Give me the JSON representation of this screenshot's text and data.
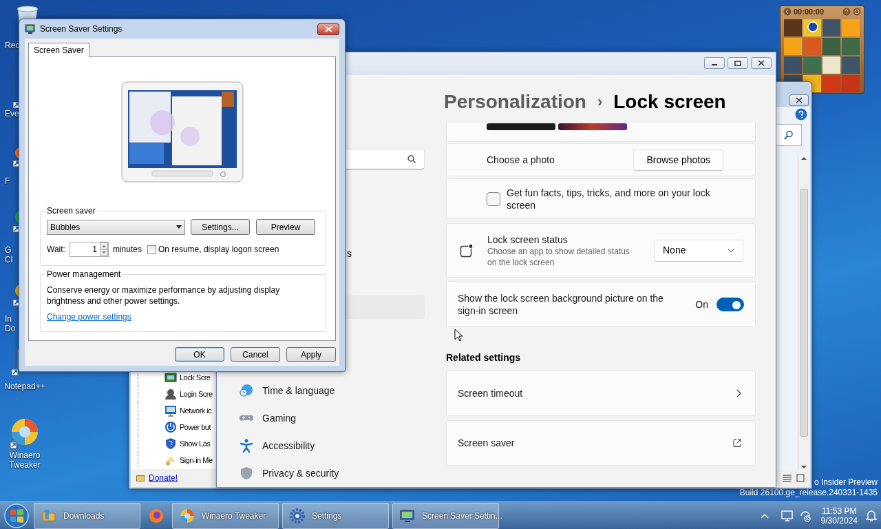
{
  "desktop_icons": [
    {
      "label": "Rec"
    },
    {
      "label": "Eve"
    },
    {
      "label": "F"
    },
    {
      "label": "G Cl"
    },
    {
      "label": "In Do"
    },
    {
      "label": "Notepad++"
    },
    {
      "label": "Winaero Tweaker"
    }
  ],
  "desktop_watermark": [
    "o Insider Preview",
    "Build 26100.ge_release.240331-1435"
  ],
  "puzzle_gadget": {
    "timer": "00:00:00"
  },
  "winaero_window": {
    "tree_items": [
      {
        "label": "Lock Scre"
      },
      {
        "label": "Login Scre"
      },
      {
        "label": "Network ic"
      },
      {
        "label": "Power but"
      },
      {
        "label": "Show Las"
      },
      {
        "label": "Sign-in Me"
      }
    ],
    "donate_link": "Donate!"
  },
  "settings_window": {
    "nav_partial_text": "s",
    "nav_items": [
      {
        "label": "Time & language"
      },
      {
        "label": "Gaming"
      },
      {
        "label": "Accessibility"
      },
      {
        "label": "Privacy & security"
      }
    ],
    "breadcrumb": {
      "parent": "Personalization",
      "separator": "›",
      "current": "Lock screen"
    },
    "choose_photo": {
      "label": "Choose a photo",
      "button": "Browse photos"
    },
    "fun_facts": {
      "label": "Get fun facts, tips, tricks, and more on your lock screen",
      "checked": false
    },
    "status": {
      "title": "Lock screen status",
      "description": "Choose an app to show detailed status on the lock screen",
      "value": "None"
    },
    "signin_background": {
      "label": "Show the lock screen background picture on the sign-in screen",
      "state_label": "On",
      "on": true
    },
    "related_title": "Related settings",
    "related": [
      {
        "label": "Screen timeout",
        "kind": "chevron"
      },
      {
        "label": "Screen saver",
        "kind": "external"
      }
    ]
  },
  "screen_saver_dialog": {
    "title": "Screen Saver Settings",
    "tabs": [
      {
        "label": "Screen Saver",
        "selected": true
      }
    ],
    "screen_saver_group": {
      "title": "Screen saver",
      "selected_saver": "Bubbles",
      "settings_button": "Settings...",
      "preview_button": "Preview",
      "wait_label": "Wait:",
      "wait_value": "1",
      "wait_unit": "minutes",
      "logon_checkbox": {
        "label": "On resume, display logon screen",
        "checked": false
      }
    },
    "power_group": {
      "title": "Power management",
      "description": "Conserve energy or maximize performance by adjusting display brightness and other power settings.",
      "link": "Change power settings"
    },
    "buttons": [
      {
        "label": "OK",
        "default": true
      },
      {
        "label": "Cancel",
        "default": false
      },
      {
        "label": "Apply",
        "default": false
      }
    ]
  },
  "taskbar": {
    "items": [
      {
        "kind": "folder",
        "label": "Downloads"
      },
      {
        "kind": "firefox"
      },
      {
        "kind": "winaero",
        "label": "Winaero Tweaker"
      },
      {
        "kind": "settings",
        "label": "Settings"
      },
      {
        "kind": "screensaver",
        "label": "Screen Saver Settin..."
      }
    ],
    "time": "11:53 PM",
    "date": "9/30/2024"
  }
}
